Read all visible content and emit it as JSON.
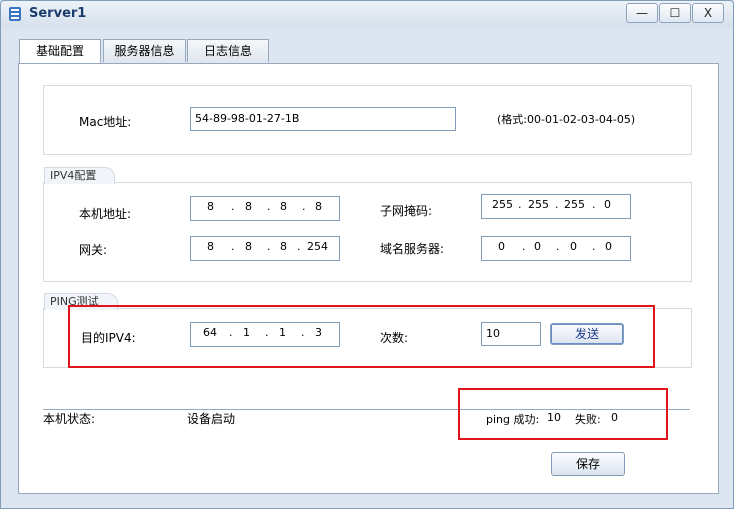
{
  "window": {
    "title": "Server1",
    "controls": {
      "minimize": "—",
      "maximize": "☐",
      "close": "X"
    }
  },
  "tabs": [
    {
      "label": "基础配置",
      "active": true
    },
    {
      "label": "服务器信息",
      "active": false
    },
    {
      "label": "日志信息",
      "active": false
    }
  ],
  "mac": {
    "label": "Mac地址:",
    "value": "54-89-98-01-27-1B",
    "format_hint": "(格式:00-01-02-03-04-05)"
  },
  "ipv4": {
    "group_label": "IPV4配置",
    "host_addr_label": "本机地址:",
    "host_addr": [
      "8",
      "8",
      "8",
      "8"
    ],
    "subnet_label": "子网掩码:",
    "subnet": [
      "255",
      "255",
      "255",
      "0"
    ],
    "gateway_label": "网关:",
    "gateway": [
      "8",
      "8",
      "8",
      "254"
    ],
    "dns_label": "域名服务器:",
    "dns": [
      "0",
      "0",
      "0",
      "0"
    ]
  },
  "ping": {
    "group_label": "PING测试",
    "dest_label": "目的IPV4:",
    "dest": [
      "64",
      "1",
      "1",
      "3"
    ],
    "count_label": "次数:",
    "count": "10",
    "send_label": "发送"
  },
  "status": {
    "label": "本机状态:",
    "value": "设备启动",
    "ping_success_label": "ping 成功:",
    "ping_success": "10",
    "fail_label": "失败:",
    "fail": "0"
  },
  "save_label": "保存",
  "colors": {
    "highlight_box": "#e0141a",
    "panel_bg": "#ffffff",
    "field_border": "#7f9db9"
  }
}
